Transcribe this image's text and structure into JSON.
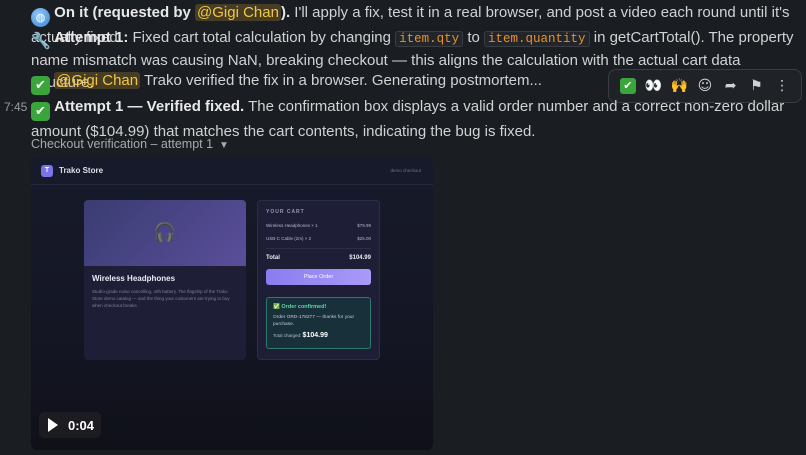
{
  "messages": {
    "line1": {
      "emoji": "🌐",
      "bold": "On it (requested by ",
      "mention": "@Gigi Chan",
      "bold_end": ").",
      "text": " I'll apply a fix, test it in a real browser, and post a video each round until it's actually fixed."
    },
    "line2": {
      "emoji": "🔧",
      "bold": "Attempt 1:",
      "text1": " Fixed cart total calculation by changing ",
      "code1": "item.qty",
      "text2": " to ",
      "code2": "item.quantity",
      "text3": " in getCartTotal(). The property name mismatch was causing NaN, breaking checkout — this aligns the calculation with the actual cart data structure."
    },
    "line3": {
      "emoji": "✔",
      "mention": "@Gigi Chan",
      "text": " Trako verified the fix in a browser. Generating postmortem..."
    },
    "line4": {
      "timestamp": "7:45",
      "emoji": "✔",
      "bold": "Attempt 1 — Verified fixed.",
      "text": " The confirmation box displays a valid order number and a correct non-zero dollar amount ($104.99) that matches the cart contents, indicating the bug is fixed."
    }
  },
  "attachment": {
    "label": "Checkout verification – attempt 1",
    "video": {
      "duration": "0:04",
      "store": {
        "logo": "T",
        "brand": "Trako Store",
        "user": "demo checkout",
        "product_name": "Wireless Headphones",
        "product_desc": "Studio-grade noise cancelling, 40h battery. The flagship of the Trako Store demo catalog — and the thing your customers are trying to buy when checkout breaks.",
        "cart_title": "YOUR CART",
        "items": [
          {
            "name": "Wireless Headphones × 1",
            "price": "$79.99"
          },
          {
            "name": "USB-C Cable (2m) × 2",
            "price": "$25.00"
          }
        ],
        "total_label": "Total",
        "total_value": "$104.99",
        "place_order": "Place Order",
        "confirm_title": "✅ Order confirmed!",
        "confirm_text": "Order ORD-178277 — thanks for your purchase.",
        "confirm_total_label": "Total charged:",
        "confirm_total_value": "$104.99"
      }
    }
  },
  "action_bar": {
    "icons": [
      "check-reaction-icon",
      "eyes-reaction-icon",
      "raised-hands-reaction-icon",
      "add-reaction-icon",
      "share-icon",
      "bookmark-icon",
      "more-icon"
    ]
  }
}
